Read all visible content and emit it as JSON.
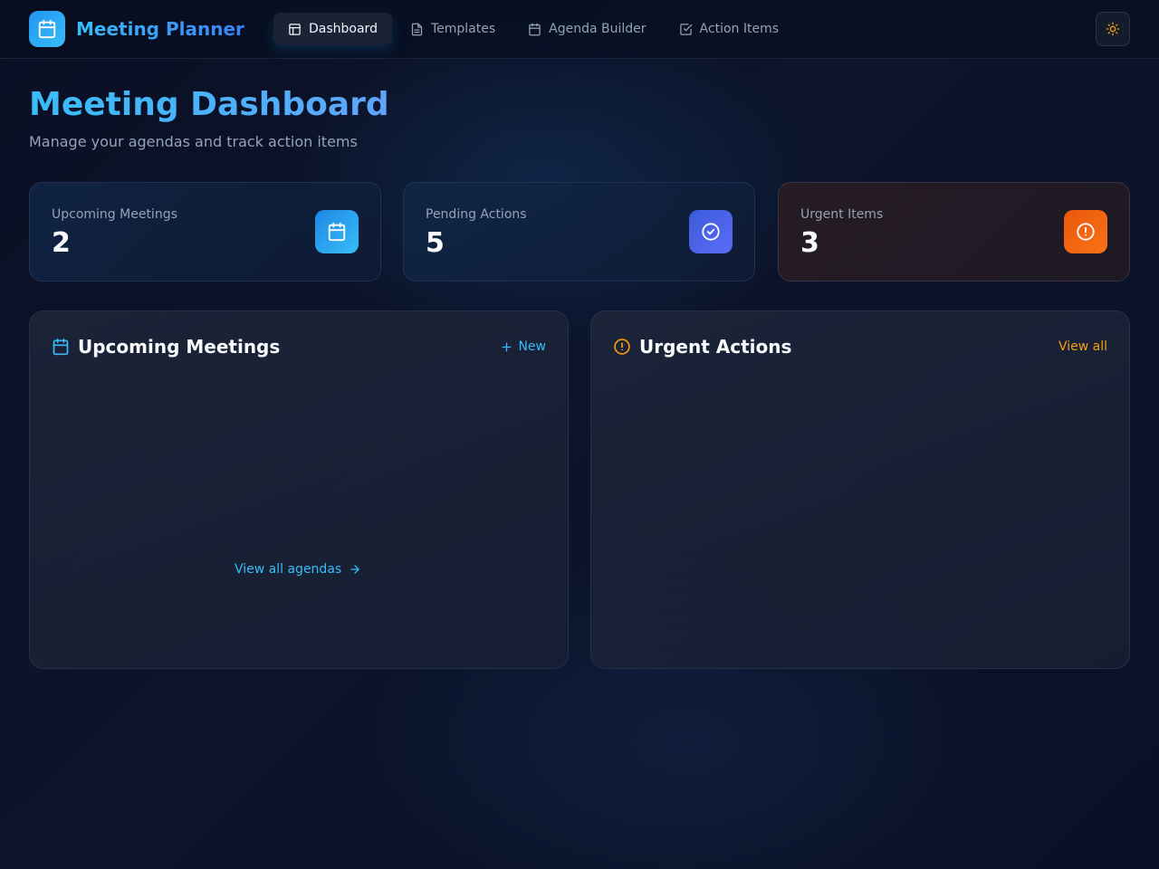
{
  "app": {
    "title": "Meeting Planner"
  },
  "nav": {
    "items": [
      {
        "label": "Dashboard",
        "icon": "layout-icon",
        "active": true
      },
      {
        "label": "Templates",
        "icon": "file-text-icon",
        "active": false
      },
      {
        "label": "Agenda Builder",
        "icon": "calendar-icon",
        "active": false
      },
      {
        "label": "Action Items",
        "icon": "check-square-icon",
        "active": false
      }
    ],
    "theme_toggle_icon": "sun-icon"
  },
  "header": {
    "title": "Meeting Dashboard",
    "subtitle": "Manage your agendas and track action items"
  },
  "stats": [
    {
      "label": "Upcoming Meetings",
      "value": "2",
      "icon": "calendar-icon",
      "color": "#2196f3"
    },
    {
      "label": "Pending Actions",
      "value": "5",
      "icon": "check-circle-icon",
      "color": "#4f63f0"
    },
    {
      "label": "Urgent Items",
      "value": "3",
      "icon": "alert-circle-icon",
      "color": "#f05a22"
    }
  ],
  "panels": {
    "upcoming": {
      "title": "Upcoming Meetings",
      "action_label": "New",
      "footer_link": "View all agendas"
    },
    "urgent": {
      "title": "Urgent Actions",
      "action_label": "View all"
    }
  },
  "colors": {
    "accent": "#38bdf8",
    "urgent_accent": "#f59e0b"
  }
}
